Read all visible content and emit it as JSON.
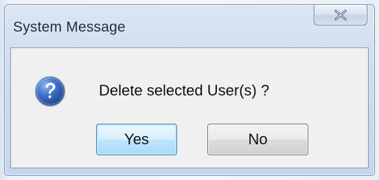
{
  "dialog": {
    "title": "System Message",
    "message": "Delete selected User(s) ?",
    "icon": "question-icon",
    "close_icon": "close-icon",
    "buttons": {
      "yes_label": "Yes",
      "no_label": "No"
    }
  },
  "colors": {
    "default_button_border": "#3c7fb1",
    "icon_blue": "#2a5fb4",
    "client_background": "#f0f0f0"
  }
}
